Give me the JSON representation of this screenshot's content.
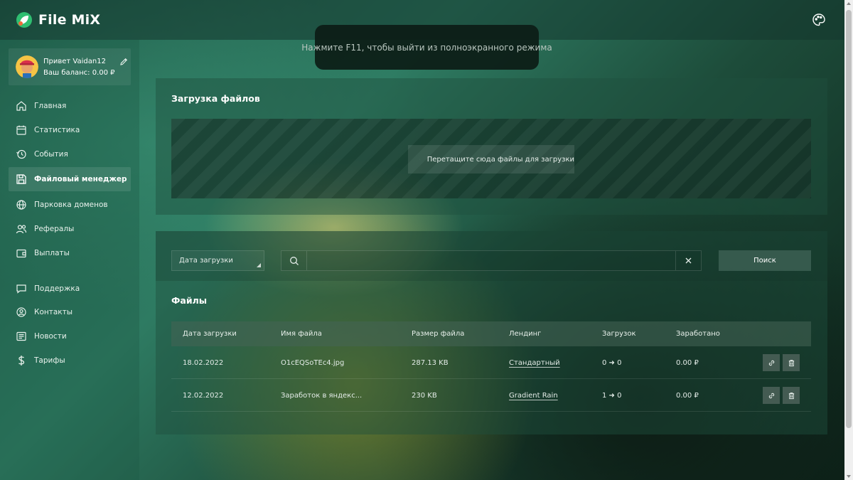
{
  "app": {
    "name": "File MiX"
  },
  "notice": {
    "text": "Нажмите F11, чтобы выйти из полноэкранного режима"
  },
  "user": {
    "greeting": "Привет Vaidan12",
    "balance": "Ваш баланс: 0.00 ₽"
  },
  "sidebar": {
    "items": [
      {
        "label": "Главная",
        "icon": "home-icon",
        "active": false
      },
      {
        "label": "Статистика",
        "icon": "calendar-icon",
        "active": false
      },
      {
        "label": "События",
        "icon": "history-icon",
        "active": false
      },
      {
        "label": "Файловый менеджер",
        "icon": "save-icon",
        "active": true
      },
      {
        "label": "Парковка доменов",
        "icon": "globe-icon",
        "active": false
      },
      {
        "label": "Рефералы",
        "icon": "users-icon",
        "active": false
      },
      {
        "label": "Выплаты",
        "icon": "wallet-icon",
        "active": false
      },
      {
        "label": "Поддержка",
        "icon": "chat-icon",
        "active": false
      },
      {
        "label": "Контакты",
        "icon": "contact-icon",
        "active": false
      },
      {
        "label": "Новости",
        "icon": "news-icon",
        "active": false
      },
      {
        "label": "Тарифы",
        "icon": "dollar-icon",
        "active": false
      }
    ]
  },
  "upload": {
    "title": "Загрузка файлов",
    "drop_label": "Перетащите сюда файлы для загрузки"
  },
  "filter": {
    "sort_value": "Дата загрузки",
    "search_value": "",
    "search_button": "Поиск"
  },
  "files": {
    "title": "Файлы",
    "columns": [
      "Дата загрузки",
      "Имя файла",
      "Размер файла",
      "Лендинг",
      "Загрузок",
      "Заработано"
    ],
    "rows": [
      {
        "date": "18.02.2022",
        "name": "O1cEQSoTEc4.jpg",
        "size": "287.13 KB",
        "landing": "Стандартный",
        "downloads": "0 ➜ 0",
        "earned": "0.00 ₽"
      },
      {
        "date": "12.02.2022",
        "name": "Заработок в яндекс...",
        "size": "230 KB",
        "landing": "Gradient Rain",
        "downloads": "1 ➜ 0",
        "earned": "0.00 ₽"
      }
    ]
  },
  "colors": {
    "accent": "#2e7b62",
    "logo_green": "#2fbf71",
    "logo_orange": "#f26b3a"
  }
}
